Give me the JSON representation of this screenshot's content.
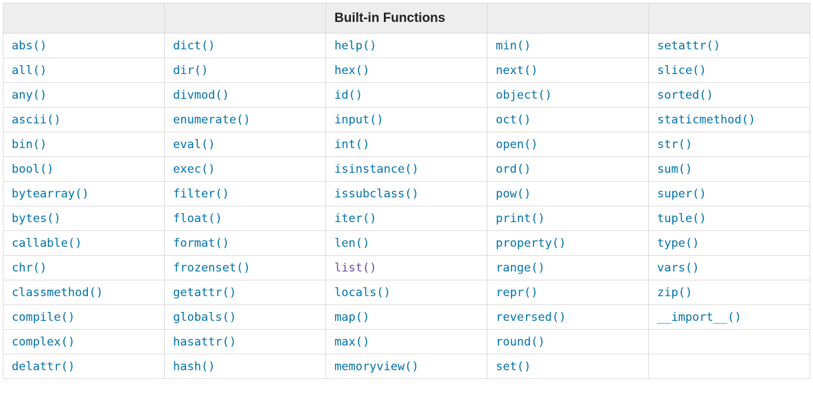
{
  "header": {
    "col0": "",
    "col1": "",
    "col2": "Built-in Functions",
    "col3": "",
    "col4": ""
  },
  "table": {
    "rows": [
      [
        "abs()",
        "dict()",
        "help()",
        "min()",
        "setattr()"
      ],
      [
        "all()",
        "dir()",
        "hex()",
        "next()",
        "slice()"
      ],
      [
        "any()",
        "divmod()",
        "id()",
        "object()",
        "sorted()"
      ],
      [
        "ascii()",
        "enumerate()",
        "input()",
        "oct()",
        "staticmethod()"
      ],
      [
        "bin()",
        "eval()",
        "int()",
        "open()",
        "str()"
      ],
      [
        "bool()",
        "exec()",
        "isinstance()",
        "ord()",
        "sum()"
      ],
      [
        "bytearray()",
        "filter()",
        "issubclass()",
        "pow()",
        "super()"
      ],
      [
        "bytes()",
        "float()",
        "iter()",
        "print()",
        "tuple()"
      ],
      [
        "callable()",
        "format()",
        "len()",
        "property()",
        "type()"
      ],
      [
        "chr()",
        "frozenset()",
        "list()",
        "range()",
        "vars()"
      ],
      [
        "classmethod()",
        "getattr()",
        "locals()",
        "repr()",
        "zip()"
      ],
      [
        "compile()",
        "globals()",
        "map()",
        "reversed()",
        "__import__()"
      ],
      [
        "complex()",
        "hasattr()",
        "max()",
        "round()",
        ""
      ],
      [
        "delattr()",
        "hash()",
        "memoryview()",
        "set()",
        ""
      ]
    ],
    "visited": {
      "row": 9,
      "col": 2
    }
  }
}
